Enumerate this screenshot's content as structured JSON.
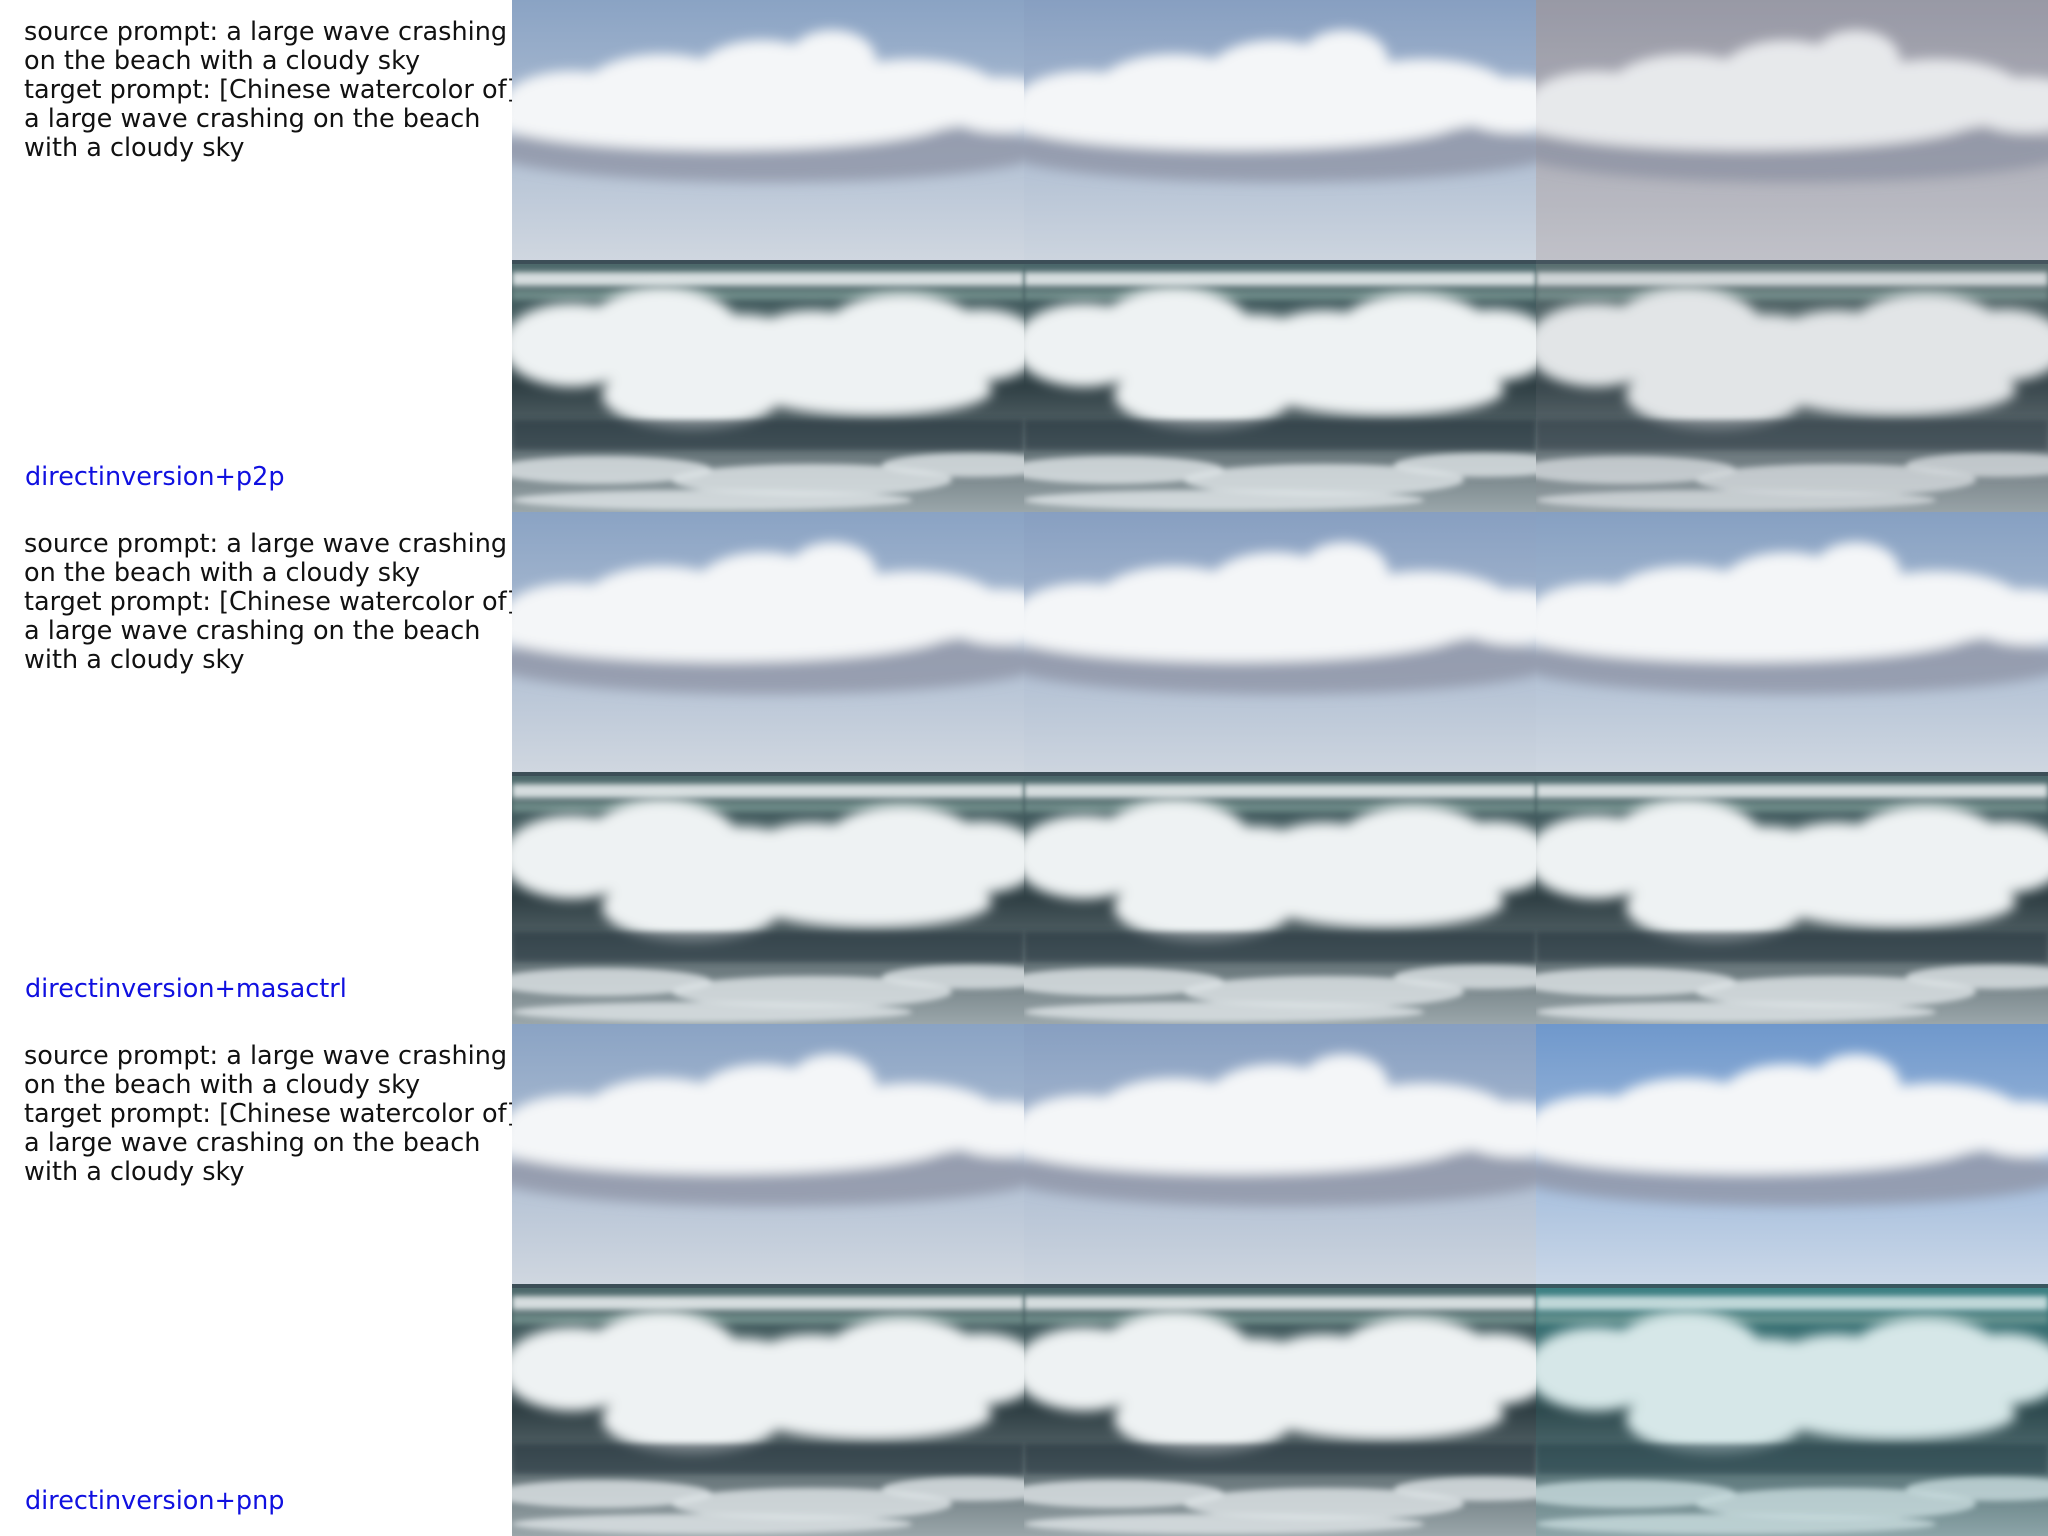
{
  "rows": [
    {
      "source_prompt": [
        "source prompt: a large wave crashing",
        "on the beach with a cloudy sky"
      ],
      "target_prompt": [
        "target prompt: [Chinese watercolor of]",
        "a large wave crashing on the beach",
        "with a cloudy sky"
      ],
      "method": "directinversion+p2p",
      "tiles": [
        {
          "sky_top": "#8aa3c4",
          "sky_bottom": "#d0d7e0",
          "sea": "#4d6a6c",
          "tint": "neutral"
        },
        {
          "sky_top": "#879fc1",
          "sky_bottom": "#cdd5df",
          "sea": "#4b686b",
          "tint": "neutral"
        },
        {
          "sky_top": "#9a9ba8",
          "sky_bottom": "#c8c9d0",
          "sea": "#556e6e",
          "tint": "muted"
        }
      ]
    },
    {
      "source_prompt": [
        "source prompt: a large wave crashing",
        "on the beach with a cloudy sky"
      ],
      "target_prompt": [
        "target prompt: [Chinese watercolor of]",
        "a large wave crashing on the beach",
        "with a cloudy sky"
      ],
      "method": "directinversion+masactrl",
      "tiles": [
        {
          "sky_top": "#8aa3c4",
          "sky_bottom": "#d0d7e0",
          "sea": "#4d6a6c",
          "tint": "neutral"
        },
        {
          "sky_top": "#879fc1",
          "sky_bottom": "#cdd5df",
          "sea": "#4b686b",
          "tint": "neutral"
        },
        {
          "sky_top": "#86a0c2",
          "sky_bottom": "#cfd7e1",
          "sea": "#4c6a6d",
          "tint": "neutral"
        }
      ]
    },
    {
      "source_prompt": [
        "source prompt: a large wave crashing",
        "on the beach with a cloudy sky"
      ],
      "target_prompt": [
        "target prompt: [Chinese watercolor of]",
        "a large wave crashing on the beach",
        "with a cloudy sky"
      ],
      "method": "directinversion+pnp",
      "tiles": [
        {
          "sky_top": "#8aa3c4",
          "sky_bottom": "#d0d7e0",
          "sea": "#4d6a6c",
          "tint": "neutral"
        },
        {
          "sky_top": "#879fc1",
          "sky_bottom": "#cdd5df",
          "sea": "#4b686b",
          "tint": "neutral"
        },
        {
          "sky_top": "#6f98cc",
          "sky_bottom": "#cbd8e8",
          "sea": "#3f7f82",
          "tint": "teal"
        }
      ]
    }
  ],
  "colors": {
    "prompt_text": "#111111",
    "method_label": "#1010e0",
    "background": "#ffffff",
    "foam": "#eef2f3",
    "cloud": "#f4f6f8",
    "cloud_shadow": "#8e95a6"
  }
}
